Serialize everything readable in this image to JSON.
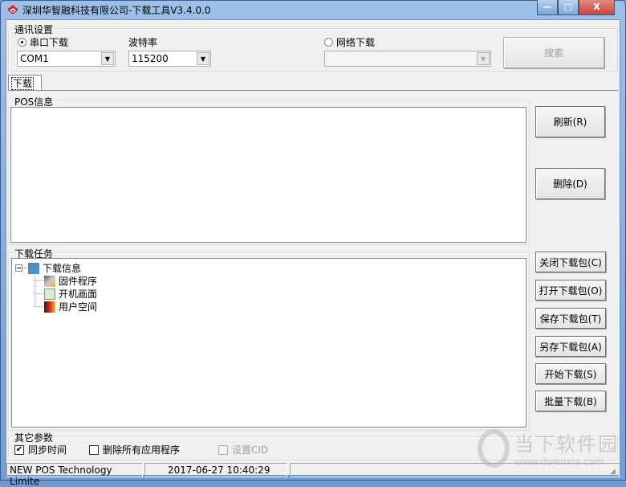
{
  "window": {
    "title": "深圳华智融科技有限公司-下载工具V3.4.0.0",
    "minimize": "—",
    "maximize": "□",
    "close": "X"
  },
  "comm": {
    "group_label": "通讯设置",
    "serial_radio": "串口下载",
    "serial_selected": true,
    "port_value": "COM1",
    "baud_label": "波特率",
    "baud_value": "115200",
    "network_radio": "网络下载",
    "network_selected": false,
    "network_value": "",
    "search_button": "搜索"
  },
  "tabs": [
    {
      "label": "下载",
      "active": true
    }
  ],
  "pos_info": {
    "group_label": "POS信息",
    "refresh_button": "刷新(R)",
    "delete_button": "删除(D)"
  },
  "tasks": {
    "group_label": "下载任务",
    "tree": {
      "root": "下载信息",
      "children": [
        "固件程序",
        "开机画面",
        "用户空间"
      ]
    },
    "buttons": [
      "关闭下载包(C)",
      "打开下载包(O)",
      "保存下载包(T)",
      "另存下载包(A)",
      "开始下载(S)",
      "批量下载(B)"
    ]
  },
  "other": {
    "group_label": "其它参数",
    "sync_time": "同步时间",
    "sync_time_checked": true,
    "delete_apps": "删除所有应用程序",
    "delete_apps_checked": false,
    "set_cid": "设置CID",
    "set_cid_checked": false,
    "set_cid_disabled": true
  },
  "status": {
    "company": "NEW POS Technology Limite",
    "datetime": "2017-06-27 10:40:29",
    "extra": ""
  },
  "watermark": {
    "name": "当下软件园",
    "url": "www.downxia.com"
  },
  "colors": {
    "title_bar": "#6f9fd6",
    "close_button": "#c9463d",
    "client_bg": "#f0f0f0"
  }
}
